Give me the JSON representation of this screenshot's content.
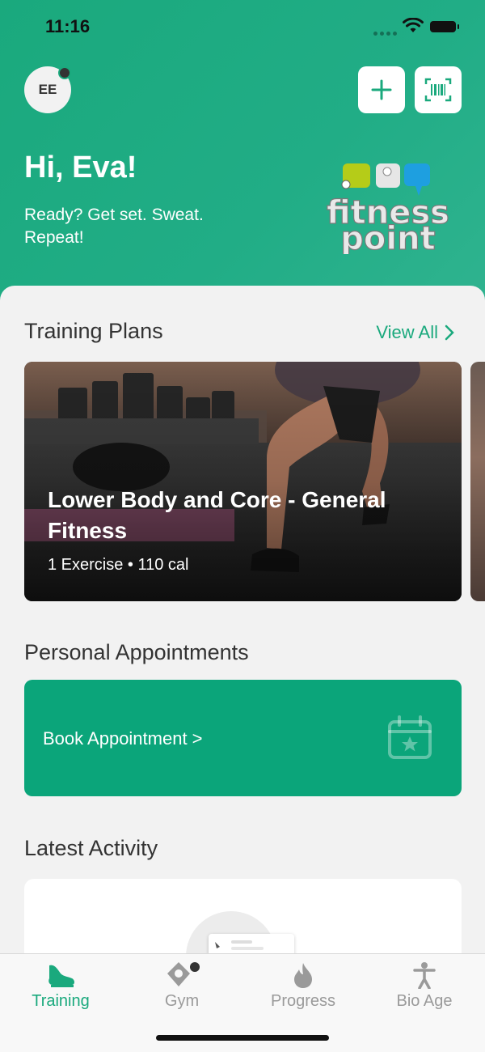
{
  "status_bar": {
    "time": "11:16"
  },
  "header": {
    "avatar_initials": "EE",
    "greeting": "Hi, Eva!",
    "tagline": "Ready? Get set. Sweat. Repeat!",
    "logo_text_line1": "fitness",
    "logo_text_line2": "point",
    "logo_colors": [
      "#b5cc18",
      "#e6e6e6",
      "#1e9fe0"
    ]
  },
  "training_plans": {
    "title": "Training Plans",
    "view_all": "View All",
    "card": {
      "title": "Lower Body and Core - General Fitness",
      "meta": "1 Exercise • 110 cal"
    }
  },
  "appointments": {
    "title": "Personal Appointments",
    "book_label": "Book Appointment >"
  },
  "latest_activity": {
    "title": "Latest Activity"
  },
  "tabbar": {
    "items": [
      {
        "label": "Training",
        "icon": "shoe-icon",
        "active": true
      },
      {
        "label": "Gym",
        "icon": "location-icon",
        "active": false
      },
      {
        "label": "Progress",
        "icon": "flame-icon",
        "active": false
      },
      {
        "label": "Bio Age",
        "icon": "person-icon",
        "active": false
      }
    ]
  },
  "colors": {
    "brand_green": "#1aa97d",
    "appointment_green": "#0ba57a",
    "background": "#f2f2f2"
  }
}
